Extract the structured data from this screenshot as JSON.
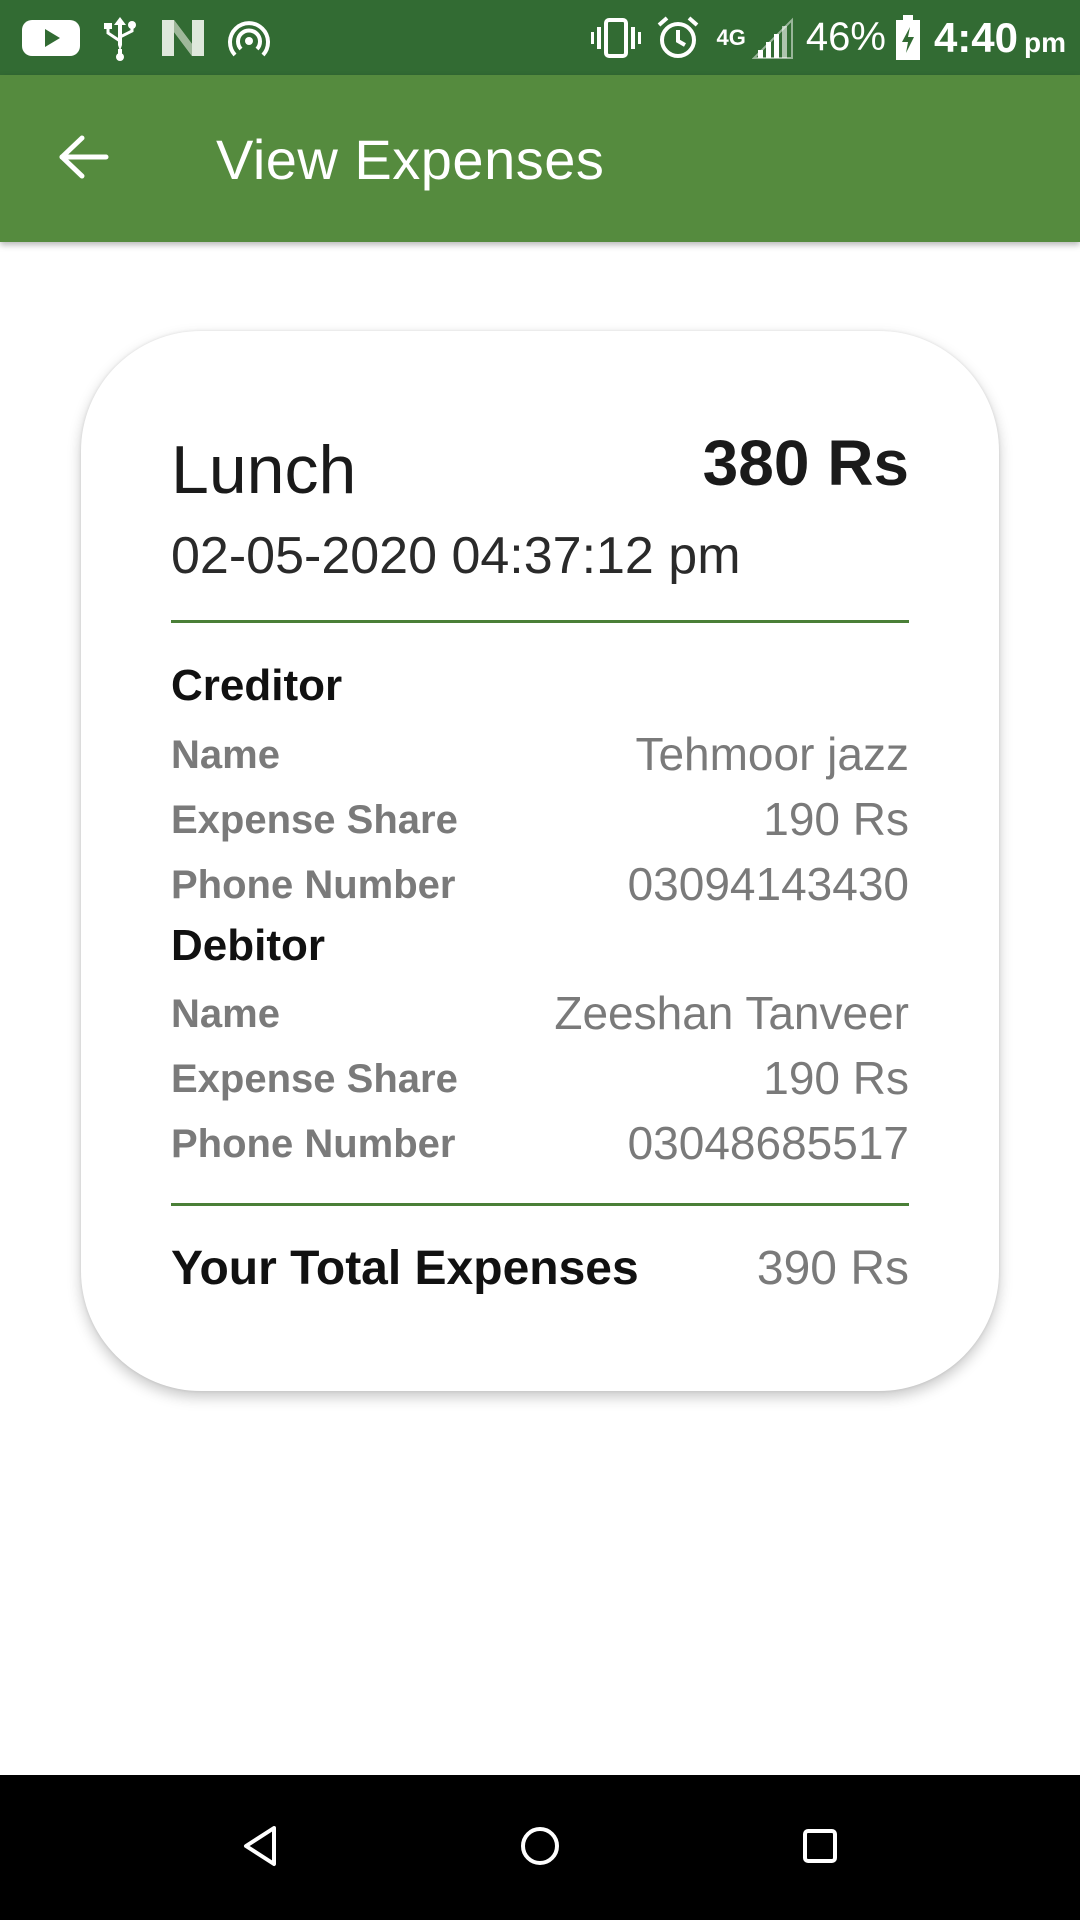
{
  "status_bar": {
    "network": "4G",
    "battery_percent": "46%",
    "time": "4:40",
    "am_pm": "pm",
    "icons": [
      "youtube-icon",
      "usb-icon",
      "n-app-icon",
      "hotspot-icon",
      "vibrate-icon",
      "alarm-icon",
      "signal-icon",
      "battery-icon"
    ]
  },
  "app_bar": {
    "title": "View Expenses",
    "back_icon": "arrow-left-icon"
  },
  "colors": {
    "status_bar": "#326b33",
    "app_bar": "#558b3e",
    "divider": "#4a7f37",
    "muted_text": "#7a7a7a"
  },
  "expense": {
    "title": "Lunch",
    "amount": "380 Rs",
    "date": "02-05-2020 04:37:12 pm",
    "creditor": {
      "label": "Creditor",
      "rows": [
        {
          "label": "Name",
          "value": "Tehmoor jazz"
        },
        {
          "label": "Expense Share",
          "value": "190 Rs"
        },
        {
          "label": "Phone Number",
          "value": "03094143430"
        }
      ]
    },
    "debitor": {
      "label": "Debitor",
      "rows": [
        {
          "label": "Name",
          "value": "Zeeshan Tanveer"
        },
        {
          "label": "Expense Share",
          "value": "190 Rs"
        },
        {
          "label": "Phone Number",
          "value": "03048685517"
        }
      ]
    },
    "total": {
      "label": "Your Total Expenses",
      "value": "390 Rs"
    }
  },
  "nav_bar": {
    "icons": [
      "back-triangle-icon",
      "home-circle-icon",
      "recents-square-icon"
    ]
  }
}
